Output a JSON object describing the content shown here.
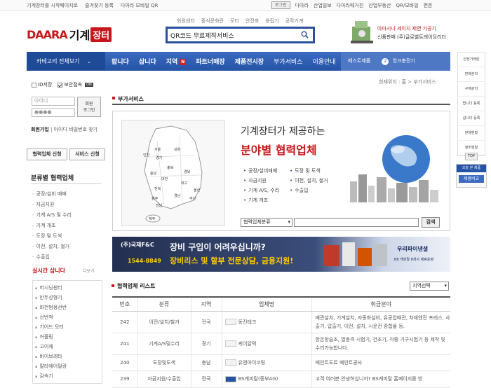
{
  "topbar": {
    "left_links": [
      "기계장터를 시작페이지로",
      "즐겨찾기 등록",
      "다아라 모바일 QR"
    ],
    "login": "로그인",
    "right_links": [
      "다아라",
      "산업일보",
      "다아라매거진",
      "산업부동산",
      "QR/모바일",
      "편존"
    ]
  },
  "subnav": [
    "회원센터",
    "중식문화관",
    "모터",
    "안전화",
    "용접기",
    "공작기계"
  ],
  "logo": {
    "brand": "DAARA",
    "name1": "기계",
    "name2": "장터"
  },
  "search": {
    "value": "QR코드 무료제작서비스"
  },
  "ad_top": {
    "line1": "아마시나 세이지 제면 가공기",
    "line2": "신품판매 (주)글로벌트레이딩리더"
  },
  "mainnav": {
    "category_all": "카테고리 전체보기",
    "items": [
      "팝니다",
      "삽니다",
      "지역",
      "파트너매장",
      "제품전시장",
      "부가서비스",
      "이용안내"
    ],
    "new_badge": "N",
    "best_label": "베스트제품",
    "best_num": "2",
    "best_item": "잉크충전기"
  },
  "login_box": {
    "save_id": "ID저장",
    "secure": "보안접속",
    "secure_tag": "ON",
    "id_placeholder": "아이디",
    "pw_placeholder": "●●●●",
    "login_line1": "회원",
    "login_line2": "로그인",
    "join": "회원가입",
    "find": "아이디 비밀번호 찾기"
  },
  "left_buttons": {
    "partner_apply": "협력업체 신청",
    "service_apply": "서비스 신청"
  },
  "categories": {
    "title": "분류별 협력업체",
    "items": [
      "공장/설비 매매",
      "자금지원",
      "기계 A/S 및 수리",
      "기계 개조",
      "도장 및 도색",
      "이전, 설치, 철거",
      "수출입"
    ]
  },
  "realtime": {
    "title": "실시간 삽니다",
    "more": "더보기",
    "items": [
      "머시닝센터",
      "만두성형기",
      "화천범용선반",
      "선반척",
      "기어드 모터",
      "커플링",
      "고이케",
      "바이브레타",
      "팔라에어필랑",
      "감속기"
    ]
  },
  "breadcrumb": "현재위치 : 홈 > 부가서비스",
  "section_title": "부가서비스",
  "partner": {
    "heading1": "기계장터가 제공하는",
    "heading2": "분야별 협력업체",
    "list_left": [
      "공장/설비매매",
      "자금지원",
      "기계 A/S, 수리",
      "기계 개조"
    ],
    "list_right": [
      "도장 및 도색",
      "이전, 설치, 철거",
      "수출입"
    ],
    "select": "협력업체분류",
    "search_btn": "검색",
    "regions": [
      "서울",
      "경기",
      "강원",
      "충북",
      "충남",
      "대전",
      "경북",
      "대구",
      "전북",
      "광주",
      "울산",
      "부산",
      "전남",
      "경남",
      "인천",
      "제주"
    ]
  },
  "banner": {
    "company": "(주)국제F&C",
    "phone": "1544-8849",
    "line1": "장비 구입이 어려우십니까?",
    "line2": "장비리스 및 할부 전문상담, 금융지원!",
    "right": "우리파이낸셜",
    "right_sub": "KB 캐피탈 8개사 제휴운영"
  },
  "list": {
    "title": "협력업체 리스트",
    "select": "지역선택",
    "headers": [
      "번호",
      "분류",
      "지역",
      "업체명",
      "취급분야"
    ],
    "rows": [
      {
        "no": "242",
        "cat": "이전/설치/철거",
        "region": "전국",
        "name": "동진테크",
        "biz": "배관설치, 기계설치, 자동화설비, 유공압배관, 차체엔진 프레스, 사출기, 압출기, 이전, 설치, 시운전 종합물 등."
      },
      {
        "no": "241",
        "cat": "기계A/S및수리",
        "region": "경기",
        "name": "케이알텍",
        "biz": "항온항습조, 열충격 시험기, 건조기, 각종 기구시험기 등 제작 및 수리가능합니다."
      },
      {
        "no": "240",
        "cat": "도장및도색",
        "region": "충남",
        "name": "유앤아이코팅",
        "biz": "페인트도료 페인트공사"
      },
      {
        "no": "239",
        "cat": "자금지원/수출입",
        "region": "전국",
        "name": "BS캐피탈(중부AG)",
        "biz": "고객 여러분 안녕하십니까? BS캐피탈 홈페이지를 방"
      }
    ]
  },
  "sidemenu": {
    "items": [
      "안전거래란",
      "판매관리",
      "구매관리",
      "팝니다 등록",
      "삽니다 등록",
      "판매현황",
      "정비현황"
    ],
    "top": "TOP",
    "today_label": "오늘 본 제품",
    "compare": "제품비교"
  }
}
